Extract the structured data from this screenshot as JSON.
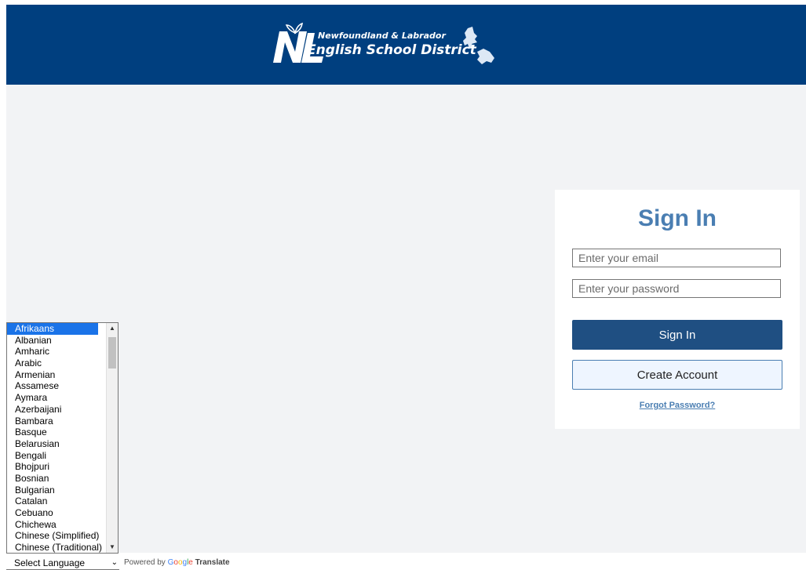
{
  "header": {
    "logo_line1": "Newfoundland & Labrador",
    "logo_line2": "English School District",
    "bg_color": "#003f7f"
  },
  "signin": {
    "title": "Sign In",
    "email_placeholder": "Enter your email",
    "password_placeholder": "Enter your password",
    "signin_label": "Sign In",
    "create_label": "Create Account",
    "forgot_label": "Forgot Password?"
  },
  "translate": {
    "languages": [
      "Afrikaans",
      "Albanian",
      "Amharic",
      "Arabic",
      "Armenian",
      "Assamese",
      "Aymara",
      "Azerbaijani",
      "Bambara",
      "Basque",
      "Belarusian",
      "Bengali",
      "Bhojpuri",
      "Bosnian",
      "Bulgarian",
      "Catalan",
      "Cebuano",
      "Chichewa",
      "Chinese (Simplified)",
      "Chinese (Traditional)"
    ],
    "selected_index": 0,
    "select_label": "Select Language",
    "powered_by": "Powered by",
    "google_letters": [
      "G",
      "o",
      "o",
      "g",
      "l",
      "e"
    ],
    "translate_word": "Translate"
  },
  "icons": {
    "scroll_up": "triangle-up-icon",
    "scroll_down": "triangle-down-icon",
    "select_chevron": "chevron-down-icon"
  },
  "colors": {
    "accent": "#4a7eb2",
    "primary_button": "#1f4f82",
    "page_bg": "#f2f3f5",
    "list_selected": "#1a73e8"
  }
}
